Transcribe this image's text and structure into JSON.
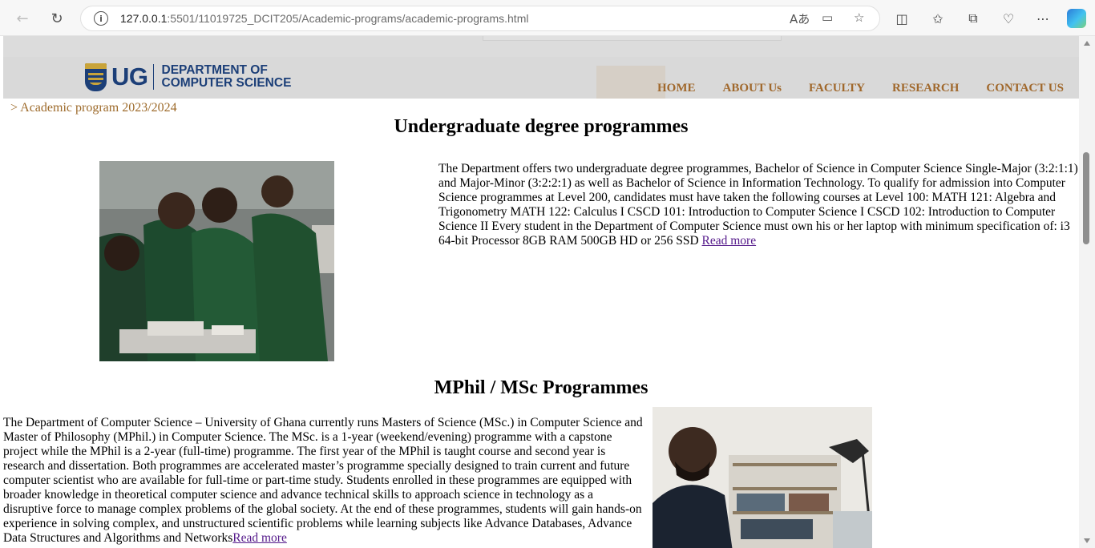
{
  "browser": {
    "url_host": "127.0.0.1",
    "url_path": ":5501/11019725_DCIT205/Academic-programs/academic-programs.html"
  },
  "header": {
    "logo_short": "UG",
    "logo_line1": "DEPARTMENT OF",
    "logo_line2": "COMPUTER SCIENCE",
    "nav": [
      "HOME",
      "ABOUT Us",
      "FACULTY",
      "RESEARCH",
      "CONTACT US"
    ],
    "colors": {
      "brand_blue": "#1c3f78",
      "nav_brown": "#a0682c",
      "header_bg": "#d9d9d9"
    }
  },
  "breadcrumb": "> Academic program 2023/2024",
  "undergrad": {
    "heading": "Undergraduate degree programmes",
    "text": "The Department offers two undergraduate degree programmes, Bachelor of Science in Computer Science Single-Major (3:2:1:1) and Major-Minor (3:2:2:1) as well as Bachelor of Science in Information Technology. To qualify for admission into Computer Science programmes at Level 200, candidates must have taken the following courses at Level 100: MATH 121: Algebra and Trigonometry MATH 122: Calculus I CSCD 101: Introduction to Computer Science I CSCD 102: Introduction to Computer Science II Every student in the Department of Computer Science must own his or her laptop with minimum specification of: i3 64-bit Processor 8GB RAM 500GB HD or 256 SSD ",
    "read_more": "Read more"
  },
  "mphil": {
    "heading": "MPhil / MSc Programmes",
    "text": "The Department of Computer Science – University of Ghana currently runs Masters of Science (MSc.) in Computer Science and Master of Philosophy (MPhil.) in Computer Science. The MSc. is a 1-year (weekend/evening) programme with a capstone project while the MPhil is a 2-year (full-time) programme. The first year of the MPhil is taught course and second year is research and dissertation. Both programmes are accelerated master’s programme specially designed to train current and future computer scientist who are available for full-time or part-time study. Students enrolled in these programmes are equipped with broader knowledge in theoretical computer science and advance technical skills to approach science in technology as a disruptive force to manage complex problems of the global society. At the end of these programmes, students will gain hands-on experience in solving complex, and unstructured scientific problems while learning subjects like Advance Databases, Advance Data Structures and Algorithms and Networks",
    "read_more": "Read more"
  }
}
